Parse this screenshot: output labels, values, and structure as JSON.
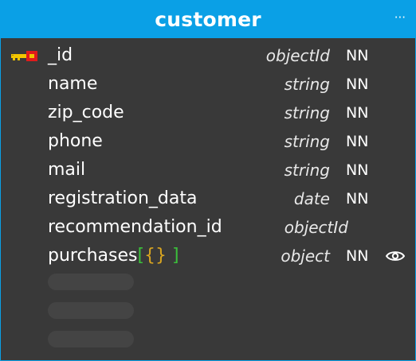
{
  "entity": {
    "title": "customer",
    "menu_label": "···",
    "colors": {
      "header": "#0aa0e6",
      "body": "#393939",
      "key_primary": "#e01b1b",
      "key_secondary": "#f2c500",
      "bracket_open": "#3bbf3b",
      "brace": "#d9a520"
    },
    "fields": [
      {
        "name": "_id",
        "type": "objectId",
        "nn": "NN",
        "icon": "primary-key-icon"
      },
      {
        "name": "name",
        "type": "string",
        "nn": "NN"
      },
      {
        "name": "zip_code",
        "type": "string",
        "nn": "NN"
      },
      {
        "name": "phone",
        "type": "string",
        "nn": "NN"
      },
      {
        "name": "mail",
        "type": "string",
        "nn": "NN"
      },
      {
        "name": "registration_data",
        "type": "date",
        "nn": "NN"
      },
      {
        "name": "recommendation_id",
        "type": "objectId",
        "nn": ""
      },
      {
        "name": "purchases",
        "bracket_open": "[",
        "braces": "{}",
        "bracket_close": " ]",
        "type": "object",
        "nn": "NN",
        "icon": "eye-icon"
      }
    ]
  }
}
